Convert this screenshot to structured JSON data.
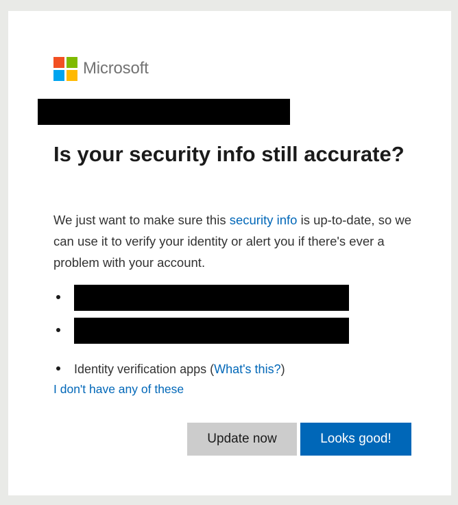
{
  "brand": {
    "name": "Microsoft",
    "logo_colors": [
      "#f25022",
      "#7fba00",
      "#00a4ef",
      "#ffb900"
    ]
  },
  "heading": "Is your security info still accurate?",
  "description": {
    "before": "We just want to make sure this ",
    "link": "security info",
    "after": " is up-to-date, so we can use it to verify your identity or alert you if there's ever a problem with your account."
  },
  "methods": {
    "apps_label": "Identity verification apps",
    "apps_open_paren": " (",
    "apps_link": "What's this?",
    "apps_close_paren": ")"
  },
  "links": {
    "none": "I don't have any of these"
  },
  "buttons": {
    "update": "Update now",
    "confirm": "Looks good!"
  },
  "colors": {
    "accent": "#0067b8",
    "secondary_button": "#cccccc"
  }
}
